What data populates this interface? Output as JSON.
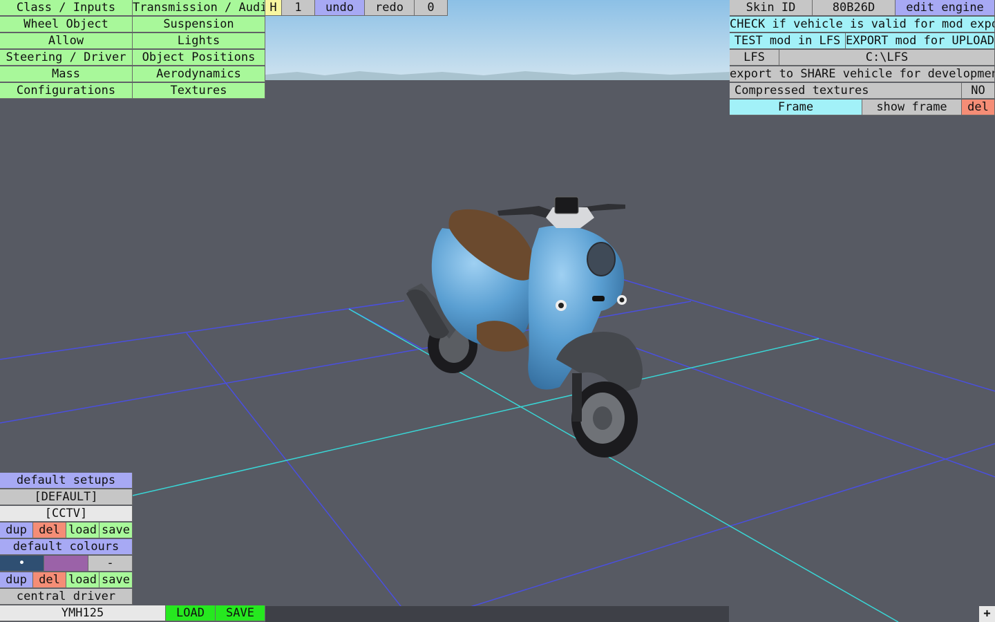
{
  "top_left_menu": {
    "col1": [
      "Class / Inputs",
      "Wheel Object",
      "Allow",
      "Steering / Driver",
      "Mass",
      "Configurations"
    ],
    "col2": [
      "Transmission / Audio",
      "Suspension",
      "Lights",
      "Object Positions",
      "Aerodynamics",
      "Textures"
    ]
  },
  "top_toolbar": {
    "h_label": "H",
    "view_number": "1",
    "undo_label": "undo",
    "redo_label": "redo",
    "count": "0"
  },
  "right_panel": {
    "skin_id_label": "Skin ID",
    "skin_id_value": "80B26D",
    "edit_engine_label": "edit engine",
    "check_label": "CHECK if vehicle is valid for mod export",
    "test_label": "TEST mod in LFS",
    "export_upload_label": "EXPORT mod for UPLOAD",
    "lfs_label": "LFS",
    "lfs_path": "C:\\LFS",
    "export_share_label": "export to SHARE vehicle for development",
    "compressed_label": "Compressed textures",
    "compressed_value": "NO",
    "frame_label": "Frame",
    "show_frame_label": "show frame",
    "del_label": "del"
  },
  "setups_panel": {
    "default_setups_label": "default setups",
    "setups": [
      "[DEFAULT]",
      "[CCTV]"
    ],
    "dup_label": "dup",
    "del_label": "del",
    "load_label": "load",
    "save_label": "save",
    "default_colours_label": "default colours",
    "swatch_blue_glyph": "•",
    "swatch_minus_glyph": "-",
    "central_driver_label": "central driver",
    "vehicle_name": "YMH125",
    "load_upper_label": "LOAD",
    "save_upper_label": "SAVE"
  },
  "corner_button_glyph": "+",
  "colors": {
    "menu_green": "#a8f89a",
    "grey": "#c6c6c6",
    "blue": "#a7a9f4",
    "cyan": "#a2f1f8",
    "red": "#f58d76",
    "yellow": "#f8f6a0",
    "bright_green": "#26e81f",
    "scooter_body": "#4f93c6",
    "seat": "#6b4a2e",
    "grid_main": "#4a4fe0",
    "grid_axis": "#39d6d6"
  }
}
